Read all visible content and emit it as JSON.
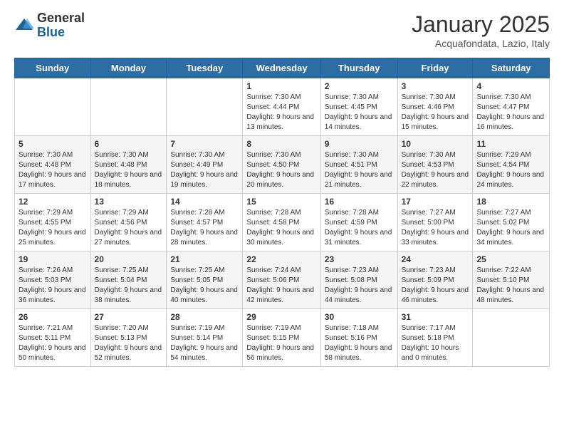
{
  "logo": {
    "general": "General",
    "blue": "Blue"
  },
  "title": {
    "month": "January 2025",
    "location": "Acquafondata, Lazio, Italy"
  },
  "days": [
    "Sunday",
    "Monday",
    "Tuesday",
    "Wednesday",
    "Thursday",
    "Friday",
    "Saturday"
  ],
  "weeks": [
    [
      {
        "day": "",
        "text": ""
      },
      {
        "day": "",
        "text": ""
      },
      {
        "day": "",
        "text": ""
      },
      {
        "day": "1",
        "text": "Sunrise: 7:30 AM\nSunset: 4:44 PM\nDaylight: 9 hours and 13 minutes."
      },
      {
        "day": "2",
        "text": "Sunrise: 7:30 AM\nSunset: 4:45 PM\nDaylight: 9 hours and 14 minutes."
      },
      {
        "day": "3",
        "text": "Sunrise: 7:30 AM\nSunset: 4:46 PM\nDaylight: 9 hours and 15 minutes."
      },
      {
        "day": "4",
        "text": "Sunrise: 7:30 AM\nSunset: 4:47 PM\nDaylight: 9 hours and 16 minutes."
      }
    ],
    [
      {
        "day": "5",
        "text": "Sunrise: 7:30 AM\nSunset: 4:48 PM\nDaylight: 9 hours and 17 minutes."
      },
      {
        "day": "6",
        "text": "Sunrise: 7:30 AM\nSunset: 4:48 PM\nDaylight: 9 hours and 18 minutes."
      },
      {
        "day": "7",
        "text": "Sunrise: 7:30 AM\nSunset: 4:49 PM\nDaylight: 9 hours and 19 minutes."
      },
      {
        "day": "8",
        "text": "Sunrise: 7:30 AM\nSunset: 4:50 PM\nDaylight: 9 hours and 20 minutes."
      },
      {
        "day": "9",
        "text": "Sunrise: 7:30 AM\nSunset: 4:51 PM\nDaylight: 9 hours and 21 minutes."
      },
      {
        "day": "10",
        "text": "Sunrise: 7:30 AM\nSunset: 4:53 PM\nDaylight: 9 hours and 22 minutes."
      },
      {
        "day": "11",
        "text": "Sunrise: 7:29 AM\nSunset: 4:54 PM\nDaylight: 9 hours and 24 minutes."
      }
    ],
    [
      {
        "day": "12",
        "text": "Sunrise: 7:29 AM\nSunset: 4:55 PM\nDaylight: 9 hours and 25 minutes."
      },
      {
        "day": "13",
        "text": "Sunrise: 7:29 AM\nSunset: 4:56 PM\nDaylight: 9 hours and 27 minutes."
      },
      {
        "day": "14",
        "text": "Sunrise: 7:28 AM\nSunset: 4:57 PM\nDaylight: 9 hours and 28 minutes."
      },
      {
        "day": "15",
        "text": "Sunrise: 7:28 AM\nSunset: 4:58 PM\nDaylight: 9 hours and 30 minutes."
      },
      {
        "day": "16",
        "text": "Sunrise: 7:28 AM\nSunset: 4:59 PM\nDaylight: 9 hours and 31 minutes."
      },
      {
        "day": "17",
        "text": "Sunrise: 7:27 AM\nSunset: 5:00 PM\nDaylight: 9 hours and 33 minutes."
      },
      {
        "day": "18",
        "text": "Sunrise: 7:27 AM\nSunset: 5:02 PM\nDaylight: 9 hours and 34 minutes."
      }
    ],
    [
      {
        "day": "19",
        "text": "Sunrise: 7:26 AM\nSunset: 5:03 PM\nDaylight: 9 hours and 36 minutes."
      },
      {
        "day": "20",
        "text": "Sunrise: 7:25 AM\nSunset: 5:04 PM\nDaylight: 9 hours and 38 minutes."
      },
      {
        "day": "21",
        "text": "Sunrise: 7:25 AM\nSunset: 5:05 PM\nDaylight: 9 hours and 40 minutes."
      },
      {
        "day": "22",
        "text": "Sunrise: 7:24 AM\nSunset: 5:06 PM\nDaylight: 9 hours and 42 minutes."
      },
      {
        "day": "23",
        "text": "Sunrise: 7:23 AM\nSunset: 5:08 PM\nDaylight: 9 hours and 44 minutes."
      },
      {
        "day": "24",
        "text": "Sunrise: 7:23 AM\nSunset: 5:09 PM\nDaylight: 9 hours and 46 minutes."
      },
      {
        "day": "25",
        "text": "Sunrise: 7:22 AM\nSunset: 5:10 PM\nDaylight: 9 hours and 48 minutes."
      }
    ],
    [
      {
        "day": "26",
        "text": "Sunrise: 7:21 AM\nSunset: 5:11 PM\nDaylight: 9 hours and 50 minutes."
      },
      {
        "day": "27",
        "text": "Sunrise: 7:20 AM\nSunset: 5:13 PM\nDaylight: 9 hours and 52 minutes."
      },
      {
        "day": "28",
        "text": "Sunrise: 7:19 AM\nSunset: 5:14 PM\nDaylight: 9 hours and 54 minutes."
      },
      {
        "day": "29",
        "text": "Sunrise: 7:19 AM\nSunset: 5:15 PM\nDaylight: 9 hours and 56 minutes."
      },
      {
        "day": "30",
        "text": "Sunrise: 7:18 AM\nSunset: 5:16 PM\nDaylight: 9 hours and 58 minutes."
      },
      {
        "day": "31",
        "text": "Sunrise: 7:17 AM\nSunset: 5:18 PM\nDaylight: 10 hours and 0 minutes."
      },
      {
        "day": "",
        "text": ""
      }
    ]
  ]
}
